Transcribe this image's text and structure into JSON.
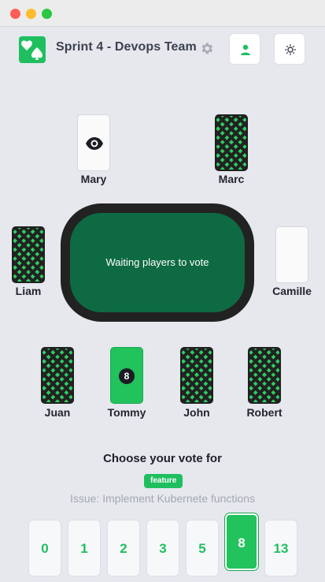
{
  "app": {
    "title": "Sprint 4 - Devops Team"
  },
  "colors": {
    "accent": "#1fbf60",
    "table_felt": "#0e6a43",
    "card_back": "#2ecc63"
  },
  "players": [
    {
      "name": "Mary",
      "card": "observer",
      "icon": "eye-icon"
    },
    {
      "name": "Marc",
      "card": "hidden"
    },
    {
      "name": "Liam",
      "card": "hidden"
    },
    {
      "name": "Camille",
      "card": "empty"
    },
    {
      "name": "Juan",
      "card": "hidden"
    },
    {
      "name": "Tommy",
      "card": "voted",
      "vote": "8"
    },
    {
      "name": "John",
      "card": "hidden"
    },
    {
      "name": "Robert",
      "card": "hidden"
    }
  ],
  "table": {
    "status": "Waiting players to vote"
  },
  "vote": {
    "heading": "Choose your vote for",
    "tag": "feature",
    "issue": "Issue: Implement Kubernete functions",
    "options": [
      "0",
      "1",
      "2",
      "3",
      "5",
      "8",
      "13"
    ],
    "selected": "8"
  }
}
